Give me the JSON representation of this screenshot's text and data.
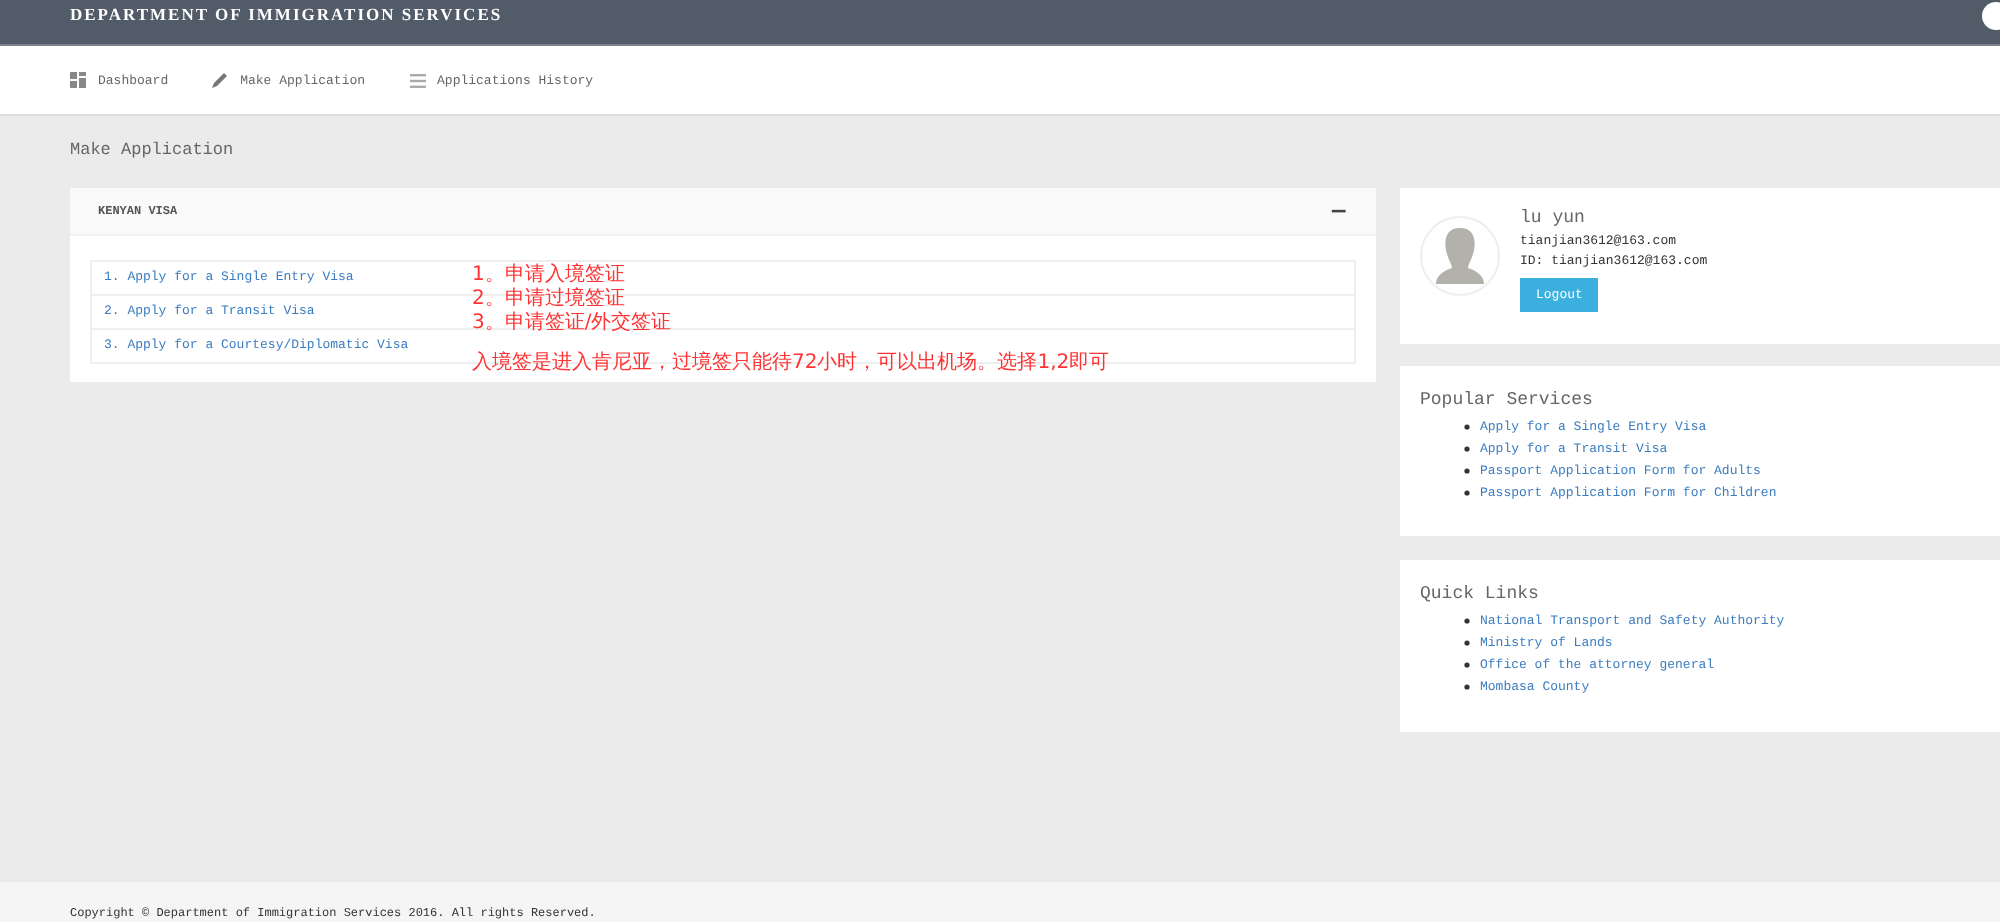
{
  "header": {
    "title": "DEPARTMENT OF IMMIGRATION SERVICES"
  },
  "nav": [
    {
      "label": "Dashboard",
      "kind": "grid",
      "selected": false
    },
    {
      "label": "Make Application",
      "kind": "pencil",
      "selected": false
    },
    {
      "label": "Applications History",
      "kind": "list",
      "selected": false
    }
  ],
  "page_title": "Make Application",
  "panel": {
    "title": "KENYAN VISA",
    "collapse_icon": "−",
    "items": [
      "1. Apply for a Single Entry Visa",
      "2. Apply for a Transit Visa",
      "3. Apply for a Courtesy/Diplomatic Visa"
    ]
  },
  "annotations": [
    "1。申请入境签证",
    "2。申请过境签证",
    "3。申请签证/外交签证",
    "入境签是进入肯尼亚，过境签只能待72小时，可以出机场。选择1,2即可"
  ],
  "profile": {
    "name": "lu yun",
    "email": "tianjian3612@163.com",
    "id": "ID: tianjian3612@163.com",
    "button": "Logout"
  },
  "popular_services": {
    "title": "Popular Services",
    "items": [
      "Apply for a Single Entry Visa",
      "Apply for a Transit Visa",
      "Passport Application Form for Adults",
      "Passport Application Form for Children"
    ]
  },
  "quick_links": {
    "title": "Quick Links",
    "items": [
      "National Transport and Safety Authority",
      "Ministry of Lands",
      "Office of the attorney general",
      "Mombasa County"
    ]
  },
  "footer": "Copyright © Department of Immigration Services 2016. All rights Reserved."
}
